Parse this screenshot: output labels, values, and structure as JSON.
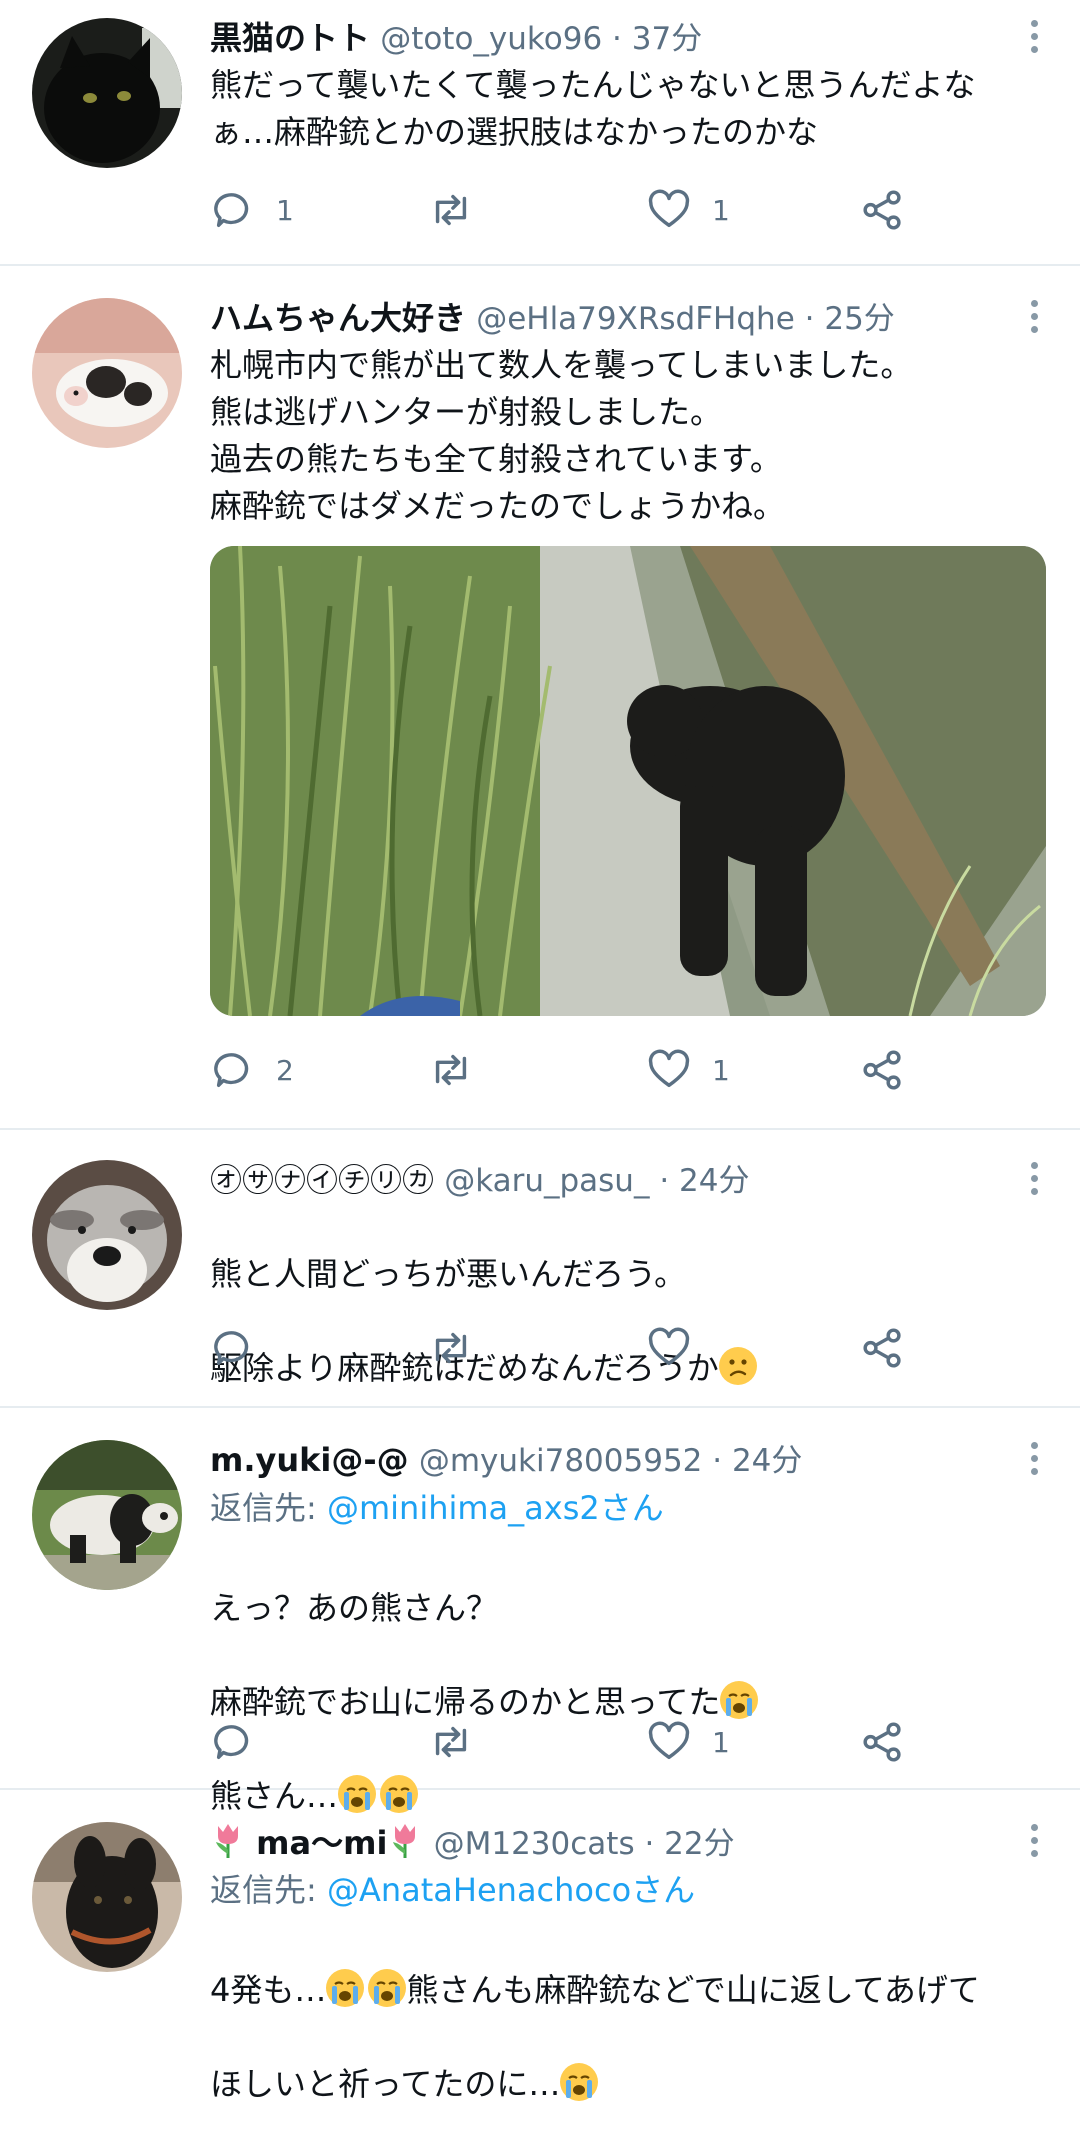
{
  "tweets": [
    {
      "name": "黒猫のトト",
      "handle": "@toto_yuko96",
      "time": "37分",
      "text": "熊だって襲いたくて襲ったんじゃないと思うんだよな\nぁ…麻酔銃とかの選択肢はなかったのかな",
      "replies": "1",
      "likes": "1"
    },
    {
      "name": "ハムちゃん大好き",
      "handle": "@eHla79XRsdFHqhe",
      "time": "25分",
      "text": "札幌市内で熊が出て数人を襲ってしまいました。\n熊は逃げハンターが射殺しました。\n過去の熊たちも全て射殺されています。\n麻酔銃ではダメだったのでしょうかね。",
      "replies": "2",
      "likes": "1"
    },
    {
      "name": "㋔㋚㋤㋑㋠㋷㋕",
      "handle": "@karu_pasu_",
      "time": "24分",
      "text_line1": "熊と人間どっちが悪いんだろう。",
      "text_line2": "駆除より麻酔銃はだめなんだろうか",
      "replies": "",
      "likes": ""
    },
    {
      "name": "m.yuki@-@",
      "handle": "@myuki78005952",
      "time": "24分",
      "reply_prefix": "返信先: ",
      "reply_to": "@minihima_axs2さん",
      "text_line1": "えっ？あの熊さん？",
      "text_line2": "麻酔銃でお山に帰るのかと思ってた",
      "text_line3": "熊さん…",
      "replies": "",
      "likes": "1"
    },
    {
      "name": "ma〜mi",
      "handle": "@M1230cats",
      "time": "22分",
      "reply_prefix": "返信先: ",
      "reply_to": "@AnataHenachocoさん",
      "text_line1a": "4発も…",
      "text_line1b": "熊さんも麻酔銃などで山に返してあげて",
      "text_line2": "ほしいと祈ってたのに…"
    }
  ],
  "separator": " · ",
  "icons": {
    "reply": "reply-icon",
    "retweet": "retweet-icon",
    "like": "heart-icon",
    "share": "share-icon",
    "more": "more-vertical-icon"
  },
  "colors": {
    "secondary_text": "#5b7083",
    "link": "#1da1f2",
    "divider": "#e6ecf0"
  }
}
